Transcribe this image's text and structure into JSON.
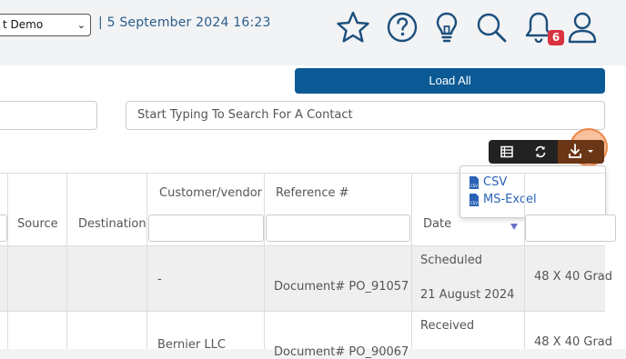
{
  "header": {
    "company_select": "t Demo",
    "date_text": "| 5 September 2024 16:23",
    "notification_count": "6"
  },
  "actions": {
    "load_all": "Load All",
    "contact_search_placeholder": "Start Typing To Search For A Contact"
  },
  "export_menu": {
    "items": [
      "CSV",
      "MS-Excel"
    ]
  },
  "table": {
    "headers": {
      "source": "Source",
      "destination": "Destination",
      "customer_vendor": "Customer/vendor",
      "reference": "Reference #",
      "date": "Date"
    },
    "rows": [
      {
        "customer": "-",
        "reference": "Document# PO_91057",
        "status": "Scheduled",
        "date": "21 August 2024",
        "item": "48 X 40 Grad"
      },
      {
        "customer": "Bernier LLC",
        "reference": "Document# PO_90067",
        "status": "Received",
        "date": "",
        "item": "48 X 40 Grad"
      }
    ]
  },
  "colors": {
    "primary": "#0b5a96",
    "badge": "#d9333f",
    "link": "#2a63b5",
    "highlight": "#f28c4a"
  }
}
